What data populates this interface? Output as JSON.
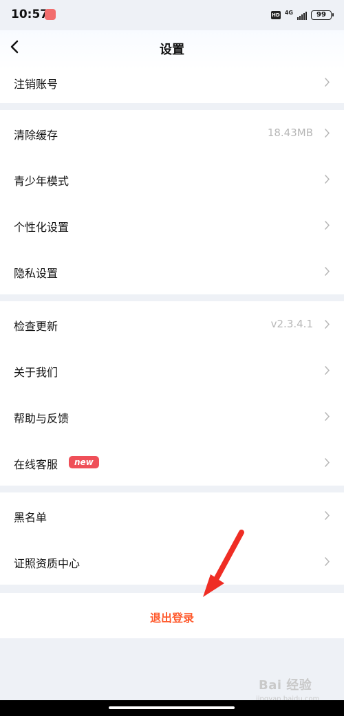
{
  "status_bar": {
    "time": "10:57",
    "hd": "HD",
    "network": "4G",
    "battery": "99"
  },
  "header": {
    "title": "设置"
  },
  "settings": {
    "account": [
      {
        "label": "注销账号"
      }
    ],
    "general": [
      {
        "label": "清除缓存",
        "value": "18.43MB"
      },
      {
        "label": "青少年模式"
      },
      {
        "label": "个性化设置"
      },
      {
        "label": "隐私设置"
      }
    ],
    "about": [
      {
        "label": "检查更新",
        "value": "v2.3.4.1"
      },
      {
        "label": "关于我们"
      },
      {
        "label": "帮助与反馈"
      },
      {
        "label": "在线客服",
        "badge": "new"
      }
    ],
    "other": [
      {
        "label": "黑名单"
      },
      {
        "label": "证照资质中心"
      }
    ]
  },
  "logout": {
    "label": "退出登录"
  },
  "watermark": {
    "brand": "Bai 经验",
    "url": "jingyan.baidu.com"
  },
  "colors": {
    "accent": "#ff5a2d",
    "badge": "#ef4f58",
    "background": "#eef1f6",
    "arrow": "#ef2d24"
  }
}
